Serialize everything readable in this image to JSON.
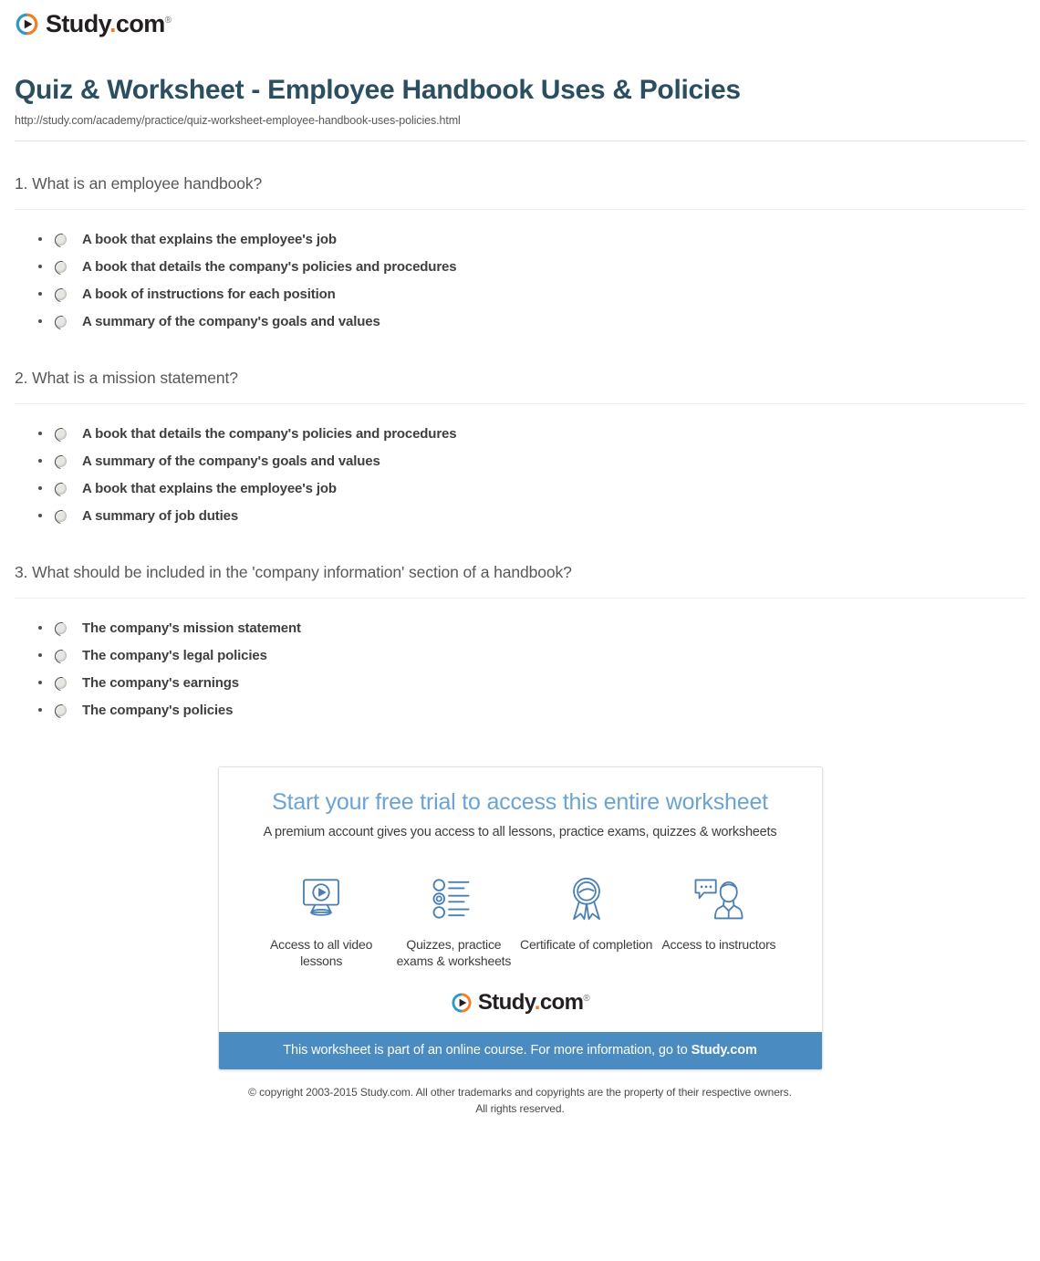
{
  "brand": {
    "name_main": "Study",
    "name_dot": ".",
    "name_suffix": "com",
    "trademark": "®",
    "icon": "play-circle-icon",
    "color_blue": "#2c9ac4",
    "color_orange": "#f07f28"
  },
  "document": {
    "title": "Quiz & Worksheet - Employee Handbook Uses & Policies",
    "url": "http://study.com/academy/practice/quiz-worksheet-employee-handbook-uses-policies.html",
    "title_color": "#2b4f60"
  },
  "questions": [
    {
      "text": "1. What is an employee handbook?",
      "options": [
        "A book that explains the employee's job",
        "A book that details the company's policies and procedures",
        "A book of instructions for each position",
        "A summary of the company's goals and values"
      ]
    },
    {
      "text": "2. What is a mission statement?",
      "options": [
        "A book that details the company's policies and procedures",
        "A summary of the company's goals and values",
        "A book that explains the employee's job",
        "A summary of job duties"
      ]
    },
    {
      "text": "3. What should be included in the 'company information' section of a handbook?",
      "options": [
        "The company's mission statement",
        "The company's legal policies",
        "The company's earnings",
        "The company's policies"
      ]
    }
  ],
  "promo": {
    "heading": "Start your free trial to access this entire worksheet",
    "subheading": "A premium account gives you access to all lessons, practice exams, quizzes & worksheets",
    "heading_color": "#6ba4d4",
    "features": [
      {
        "icon": "monitor-play-icon",
        "label": "Access to all video lessons"
      },
      {
        "icon": "quiz-list-icon",
        "label": "Quizzes, practice exams & worksheets"
      },
      {
        "icon": "award-ribbon-icon",
        "label": "Certificate of completion"
      },
      {
        "icon": "instructor-chat-icon",
        "label": "Access to instructors"
      }
    ],
    "banner_text_before": "This worksheet is part of an online course. For more information, go to ",
    "banner_link": "Study.com",
    "banner_color": "#4a8bc2"
  },
  "footer": {
    "copyright_line1": "© copyright 2003-2015 Study.com. All other trademarks and copyrights are the property of their respective owners.",
    "copyright_line2": "All rights reserved."
  }
}
